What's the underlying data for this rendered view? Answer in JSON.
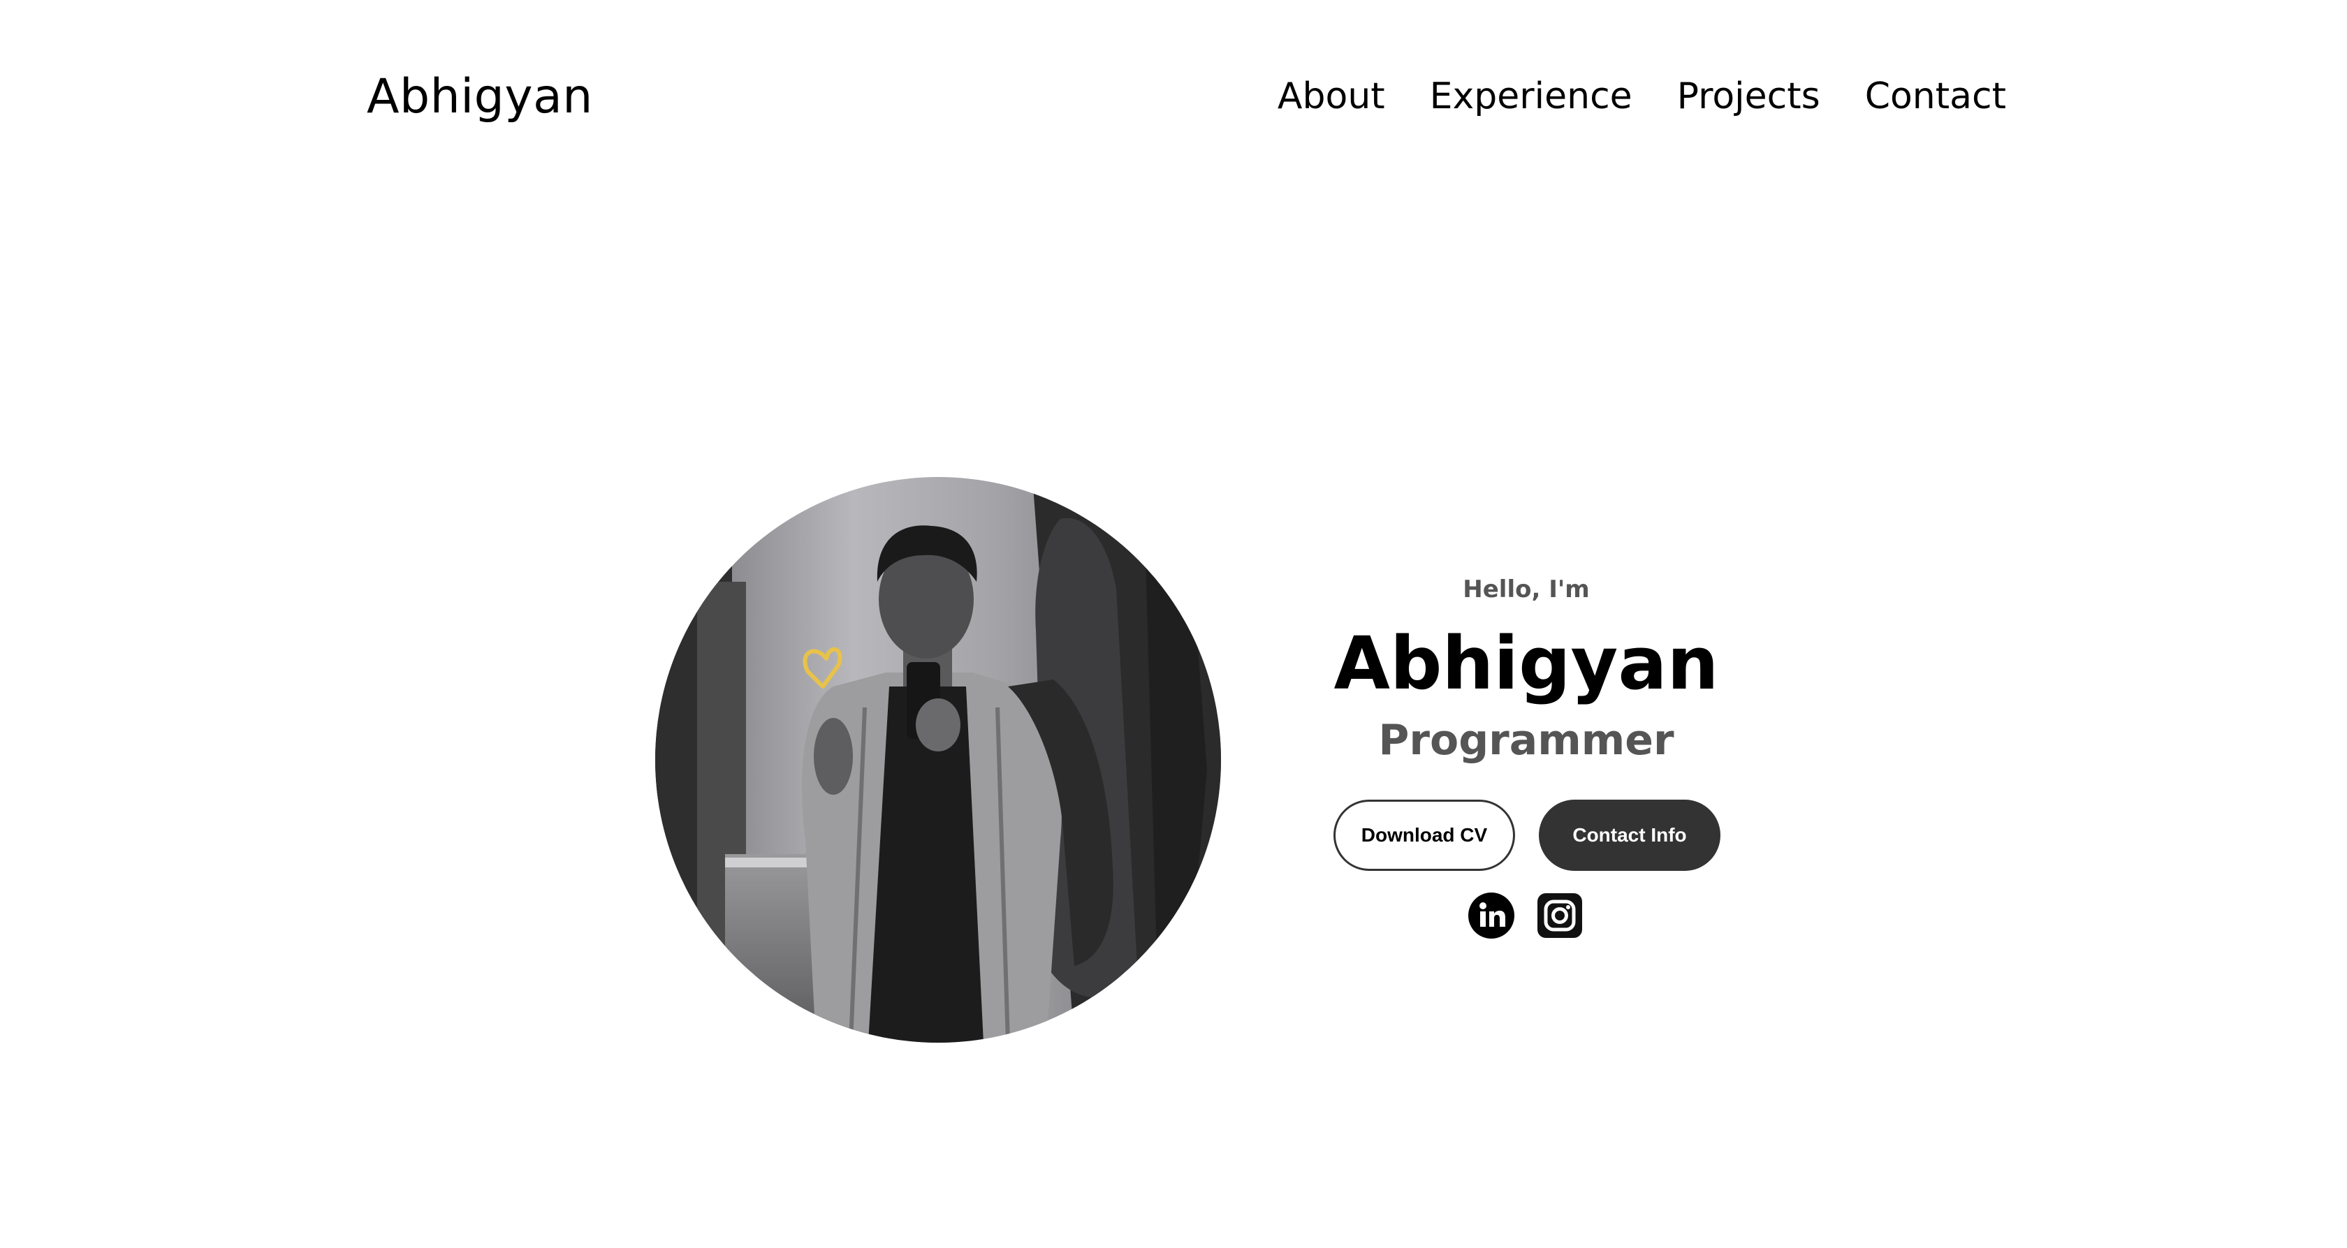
{
  "header": {
    "logo": "Abhigyan",
    "nav": [
      "About",
      "Experience",
      "Projects",
      "Contact"
    ]
  },
  "hero": {
    "greeting": "Hello, I'm",
    "name": "Abhigyan",
    "role": "Programmer",
    "buttons": {
      "download_cv": "Download CV",
      "contact_info": "Contact Info"
    },
    "social_icons": [
      "linkedin-icon",
      "instagram-icon"
    ],
    "profile_picture": "profile-photo"
  },
  "colors": {
    "background": "#ffffff",
    "text": "#000000",
    "muted_text": "#555555",
    "button_dark": "#333333",
    "heart_accent": "#e8c24a"
  }
}
